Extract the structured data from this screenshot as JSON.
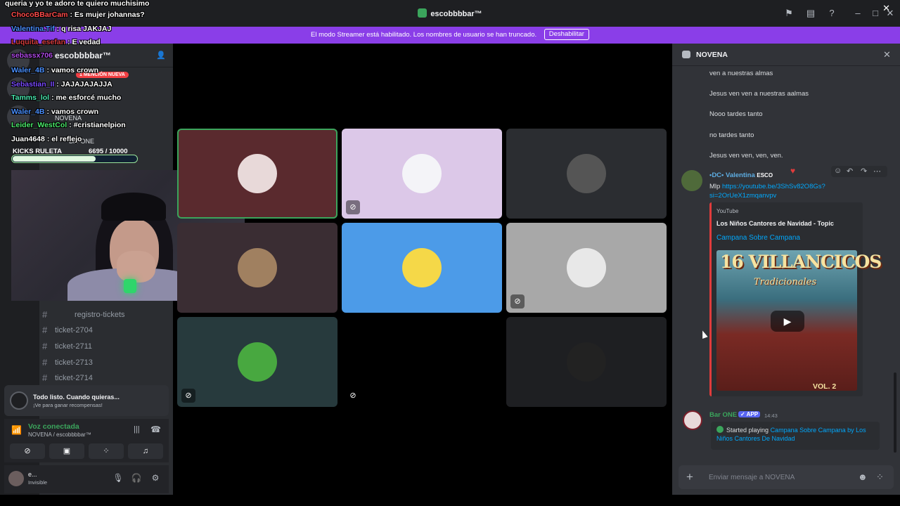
{
  "window": {
    "title": "escobbbbar™"
  },
  "title_icons": [
    "flag-icon",
    "inbox-icon",
    "help-icon",
    "minimize-icon",
    "maximize-icon",
    "close-icon"
  ],
  "banner": {
    "text": "El modo Streamer está habilitado. Los nombres de usuario se han truncado.",
    "button": "Deshabilitar",
    "close": "✕"
  },
  "overlay_chat": [
    {
      "name": "",
      "msg": "queria y yo te adoro te quiero muchisimo",
      "color": "#ffffff"
    },
    {
      "name": "ChocoBBarCam",
      "msg": ": Es mujer johannas?",
      "color": "#ff4a4a"
    },
    {
      "name": "Valentina.Tif",
      "msg": ": q risa JAKJAJ",
      "color": "#4a90ff"
    },
    {
      "name": "Luquita_esefan",
      "msg": ": E vedad",
      "color": "#d43c3c"
    },
    {
      "name": "sebassx706",
      "msg": "",
      "color": "#b04ae8"
    },
    {
      "name": "Waler_4B",
      "msg": ": vamos crown",
      "color": "#4a90ff"
    },
    {
      "name": "Sebastian_II",
      "msg": ": JAJAJAJAJJA",
      "color": "#7a4aff"
    },
    {
      "name": "Tamms_lol",
      "msg": ": me esforcé mucho",
      "color": "#4ae8b0"
    },
    {
      "name": "Waler_4B",
      "msg": ": vamos crown",
      "color": "#4a90ff"
    },
    {
      "name": "Leider_WestCol",
      "msg": ": #cristianelpion",
      "color": "#4ae86a"
    },
    {
      "name": "Juan4648",
      "msg": ": el reflejo",
      "color": "#ffffff"
    }
  ],
  "sidebar": {
    "server_title": "escobbbbar™",
    "mention_badge": "1 MENCIÓN NUEVA",
    "voice_channel": "NOVENA",
    "voice_user": "Bar ONE",
    "channels": [
      {
        "label": "registro-tickets"
      },
      {
        "label": "ticket-2704"
      },
      {
        "label": "ticket-2711"
      },
      {
        "label": "ticket-2713"
      },
      {
        "label": "ticket-2714"
      }
    ]
  },
  "kick": {
    "label": "KICKS RULETA",
    "current": "6695",
    "total": "/ 10000",
    "progress_percent": 67
  },
  "notice": {
    "title": "Todo listo. Cuando quieras...",
    "subtitle": "¡Ve para ganar recompensas!"
  },
  "voice": {
    "status": "Voz conectada",
    "channel": "NOVENA / escobbbbar™"
  },
  "user": {
    "name": "e...",
    "status": "Invisible"
  },
  "tiles": [
    {
      "bg": "#5a2a2e",
      "border": "#3ba55c",
      "avatar": "#e8d9d9",
      "muted": false
    },
    {
      "bg": "#dcc8e8",
      "border": "",
      "avatar": "#f4f4f8",
      "muted": true
    },
    {
      "bg": "#2b2d31",
      "border": "",
      "avatar": "#555555",
      "muted": false
    },
    {
      "bg": "#3a2d33",
      "border": "",
      "avatar": "#a08060",
      "muted": false
    },
    {
      "bg": "#4c9be8",
      "border": "",
      "avatar": "#f5d848",
      "muted": false
    },
    {
      "bg": "#a8a8a8",
      "border": "",
      "avatar": "#e8e8e8",
      "muted": true
    },
    {
      "bg": "#273a3d",
      "border": "",
      "avatar": "#48a840",
      "muted": true
    },
    {
      "bg": "#000000",
      "border": "",
      "avatar": "#000000",
      "muted": true
    },
    {
      "bg": "#1e1f22",
      "border": "",
      "avatar": "#222222",
      "muted": false
    }
  ],
  "thread": {
    "title": "NOVENA",
    "messages": [
      "ven a nuestras almas",
      "Jesus ven ven a nuestras aalmas",
      "Nooo tardes tanto",
      "no tardes tanto",
      "Jesus ven ven, ven, ven."
    ],
    "post": {
      "author": "•DC• Valentina",
      "tag": "ESCO",
      "text_prefix": "Mlp",
      "link": "https://youtube.be/3ShSv82O8Gs?si=2OrUeX1zmqanvpv",
      "embed": {
        "provider": "YouTube",
        "author": "Los Niños Cantores de Navidad - Topic",
        "title": "Campana Sobre Campana",
        "thumb_title": "16 VILLANCICOS",
        "thumb_subtitle": "Tradicionales",
        "thumb_vol": "VOL. 2"
      }
    },
    "bot": {
      "name": "Bar ONE",
      "badge": "✓ APP",
      "time": "14:43",
      "text": "Started playing",
      "link": "Campana Sobre Campana by Los Niños Cantores De Navidad"
    },
    "input_placeholder": "Enviar mensaje a NOVENA"
  }
}
